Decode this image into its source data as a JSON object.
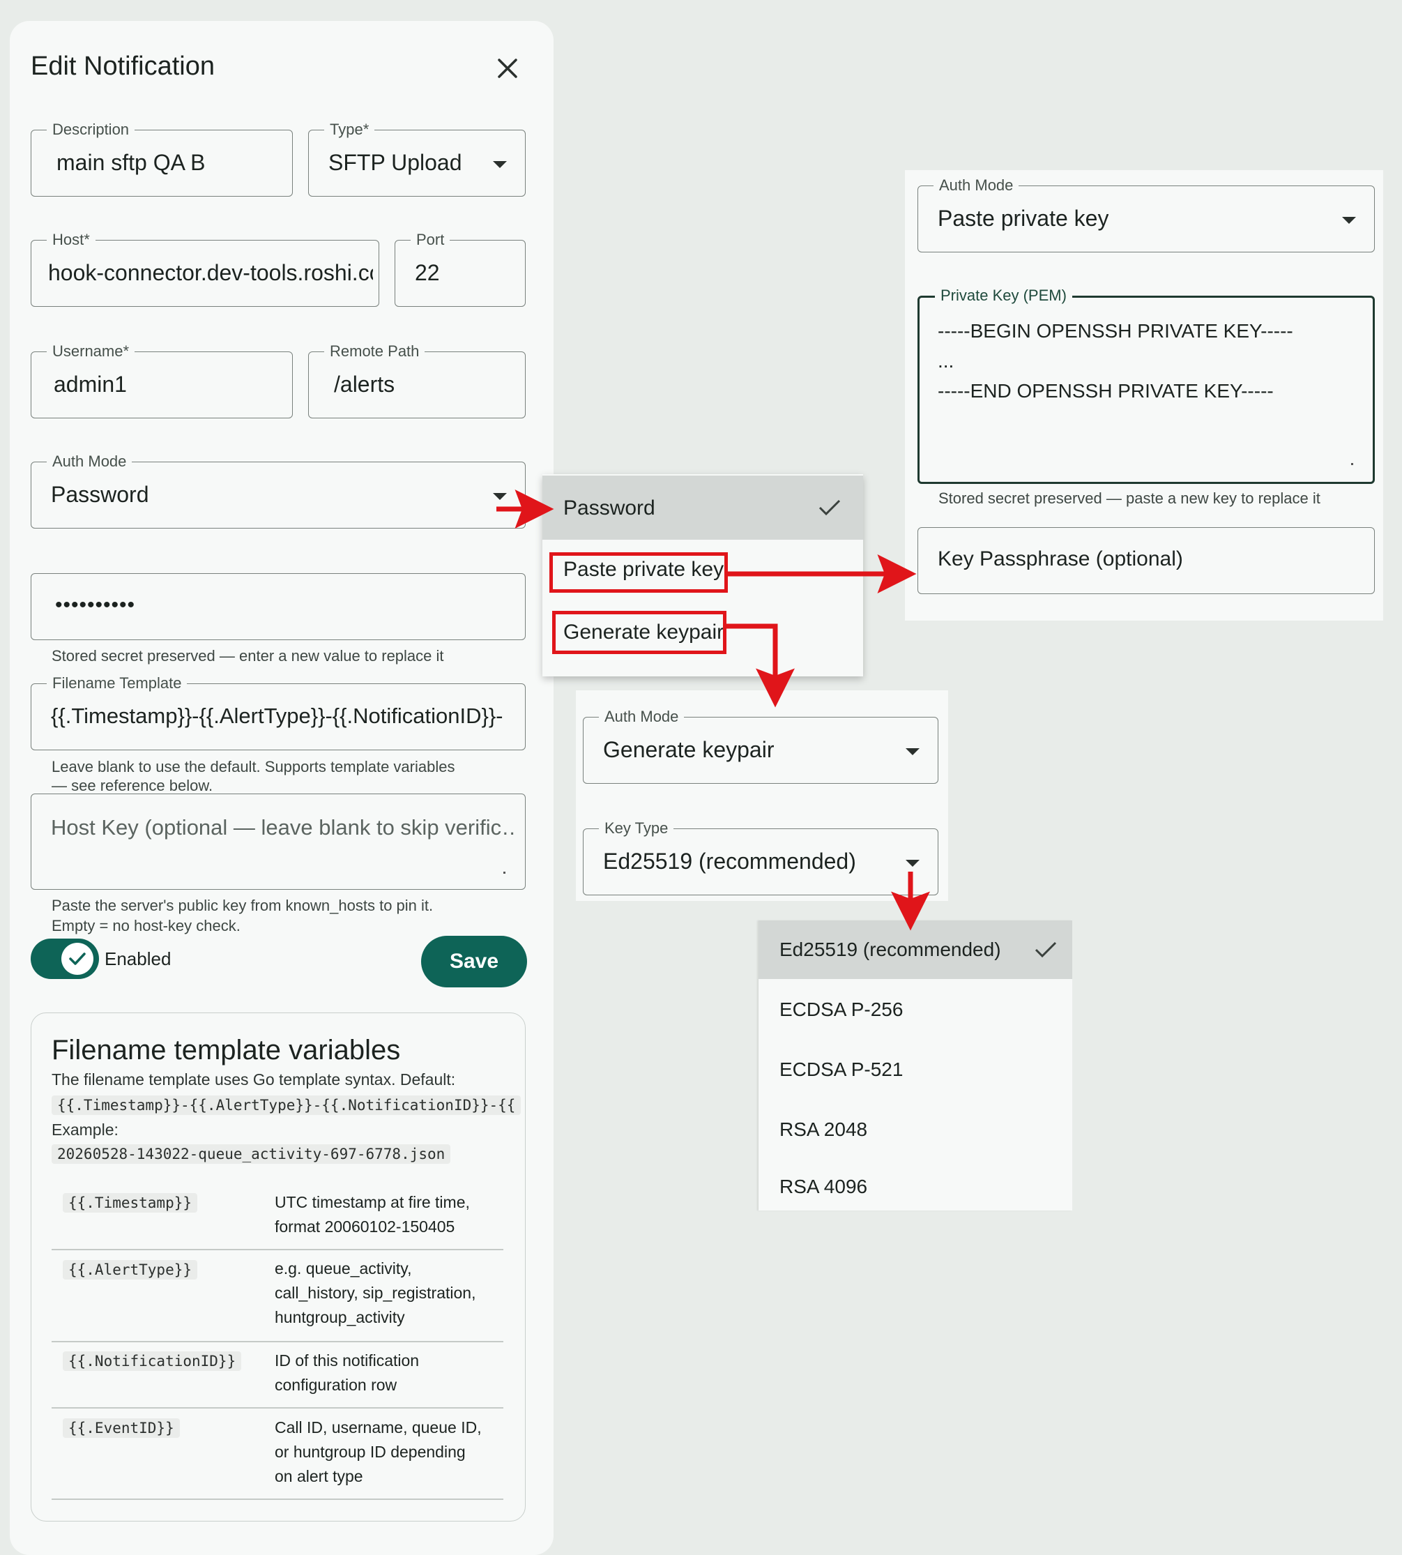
{
  "dialog": {
    "title": "Edit Notification",
    "close_icon": "close-icon",
    "description": {
      "label": "Description",
      "value": "main sftp QA B"
    },
    "type": {
      "label": "Type*",
      "value": "SFTP Upload"
    },
    "host": {
      "label": "Host*",
      "value": "hook-connector.dev-tools.roshi.co"
    },
    "port": {
      "label": "Port",
      "value": "22"
    },
    "username": {
      "label": "Username*",
      "value": "admin1"
    },
    "remote_path": {
      "label": "Remote Path",
      "value": "/alerts"
    },
    "auth_mode": {
      "label": "Auth Mode",
      "value": "Password"
    },
    "password": {
      "value": "••••••••••",
      "helper": "Stored secret preserved — enter a new value to replace it"
    },
    "filename_template": {
      "label": "Filename Template",
      "value": "{{.Timestamp}}-{{.AlertType}}-{{.NotificationID}}-",
      "helper_line1": "Leave blank to use the default. Supports template variables",
      "helper_line2": "— see reference below."
    },
    "host_key": {
      "placeholder": "Host Key (optional — leave blank to skip verific…",
      "helper_line1": "Paste the server's public key from known_hosts to pin it.",
      "helper_line2": "Empty = no host-key check."
    },
    "enabled": {
      "label": "Enabled",
      "on": true
    },
    "save_label": "Save"
  },
  "reference": {
    "title": "Filename template variables",
    "intro": "The filename template uses Go template syntax. Default:",
    "default_code": "{{.Timestamp}}-{{.AlertType}}-{{.NotificationID}}-{{",
    "example_label": "Example:",
    "example_code": "20260528-143022-queue_activity-697-6778.json",
    "rows": [
      {
        "var": "{{.Timestamp}}",
        "desc": [
          "UTC timestamp at fire time,",
          "format 20060102-150405"
        ]
      },
      {
        "var": "{{.AlertType}}",
        "desc": [
          "e.g. queue_activity,",
          "call_history, sip_registration,",
          "huntgroup_activity"
        ]
      },
      {
        "var": "{{.NotificationID}}",
        "desc": [
          "ID of this notification",
          "configuration row"
        ]
      },
      {
        "var": "{{.EventID}}",
        "desc": [
          "Call ID, username, queue ID,",
          "or huntgroup ID depending",
          "on alert type"
        ]
      }
    ]
  },
  "auth_menu": {
    "items": [
      "Password",
      "Paste private key",
      "Generate keypair"
    ],
    "selected": "Password"
  },
  "paste_key_panel": {
    "auth_mode": {
      "label": "Auth Mode",
      "value": "Paste private key"
    },
    "private_key": {
      "label": "Private Key (PEM)",
      "lines": [
        "-----BEGIN OPENSSH PRIVATE KEY-----",
        "...",
        "-----END OPENSSH PRIVATE KEY-----"
      ]
    },
    "helper": "Stored secret preserved — paste a new key to replace it",
    "passphrase_placeholder": "Key Passphrase (optional)"
  },
  "keypair_panel": {
    "auth_mode": {
      "label": "Auth Mode",
      "value": "Generate keypair"
    },
    "key_type": {
      "label": "Key Type",
      "value": "Ed25519 (recommended)"
    }
  },
  "key_type_menu": {
    "items": [
      "Ed25519 (recommended)",
      "ECDSA P-256",
      "ECDSA P-521",
      "RSA 2048",
      "RSA 4096"
    ],
    "selected": "Ed25519 (recommended)"
  },
  "colors": {
    "accent": "#0e6457",
    "annotation": "#e0151a",
    "panel": "#f7f9f8",
    "background": "#e8ece9"
  }
}
